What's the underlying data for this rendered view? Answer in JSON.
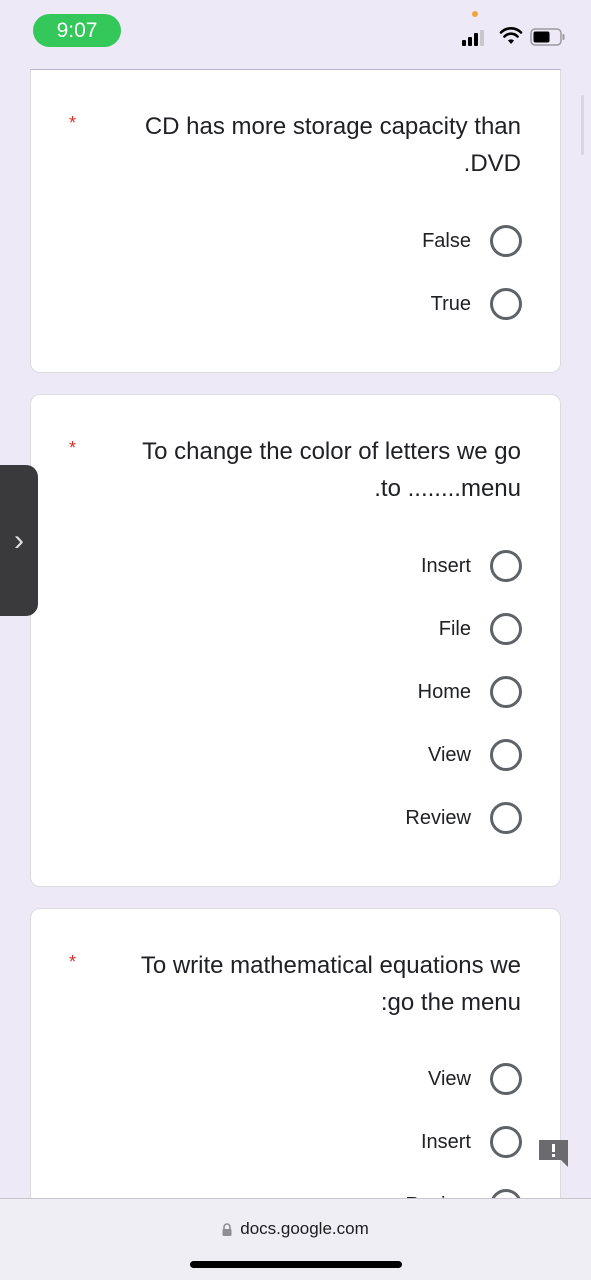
{
  "status_bar": {
    "time": "9:07",
    "icons": [
      "cellular-signal-icon",
      "wifi-icon",
      "battery-icon"
    ]
  },
  "questions": [
    {
      "required_marker": "*",
      "lines": [
        "CD has more storage capacity than",
        ".DVD"
      ],
      "options": [
        "False",
        "True"
      ],
      "selected": null
    },
    {
      "required_marker": "*",
      "lines": [
        "To change the color of letters we go",
        ".to ........menu"
      ],
      "options": [
        "Insert",
        "File",
        "Home",
        "View",
        "Review"
      ],
      "selected": null
    },
    {
      "required_marker": "*",
      "lines": [
        "To write mathematical equations we",
        ":go the menu"
      ],
      "options": [
        "View",
        "Insert",
        "Review"
      ],
      "selected": null
    }
  ],
  "side_handle": {
    "icon": "chevron-right-icon",
    "glyph": "›"
  },
  "feedback_button": {
    "icon": "report-feedback-icon",
    "glyph": "!"
  },
  "browser": {
    "url": "docs.google.com",
    "icon": "lock-icon"
  },
  "colors": {
    "accent_required": "#d93025",
    "time_pill": "#34c759",
    "background": "#ede9f6"
  }
}
